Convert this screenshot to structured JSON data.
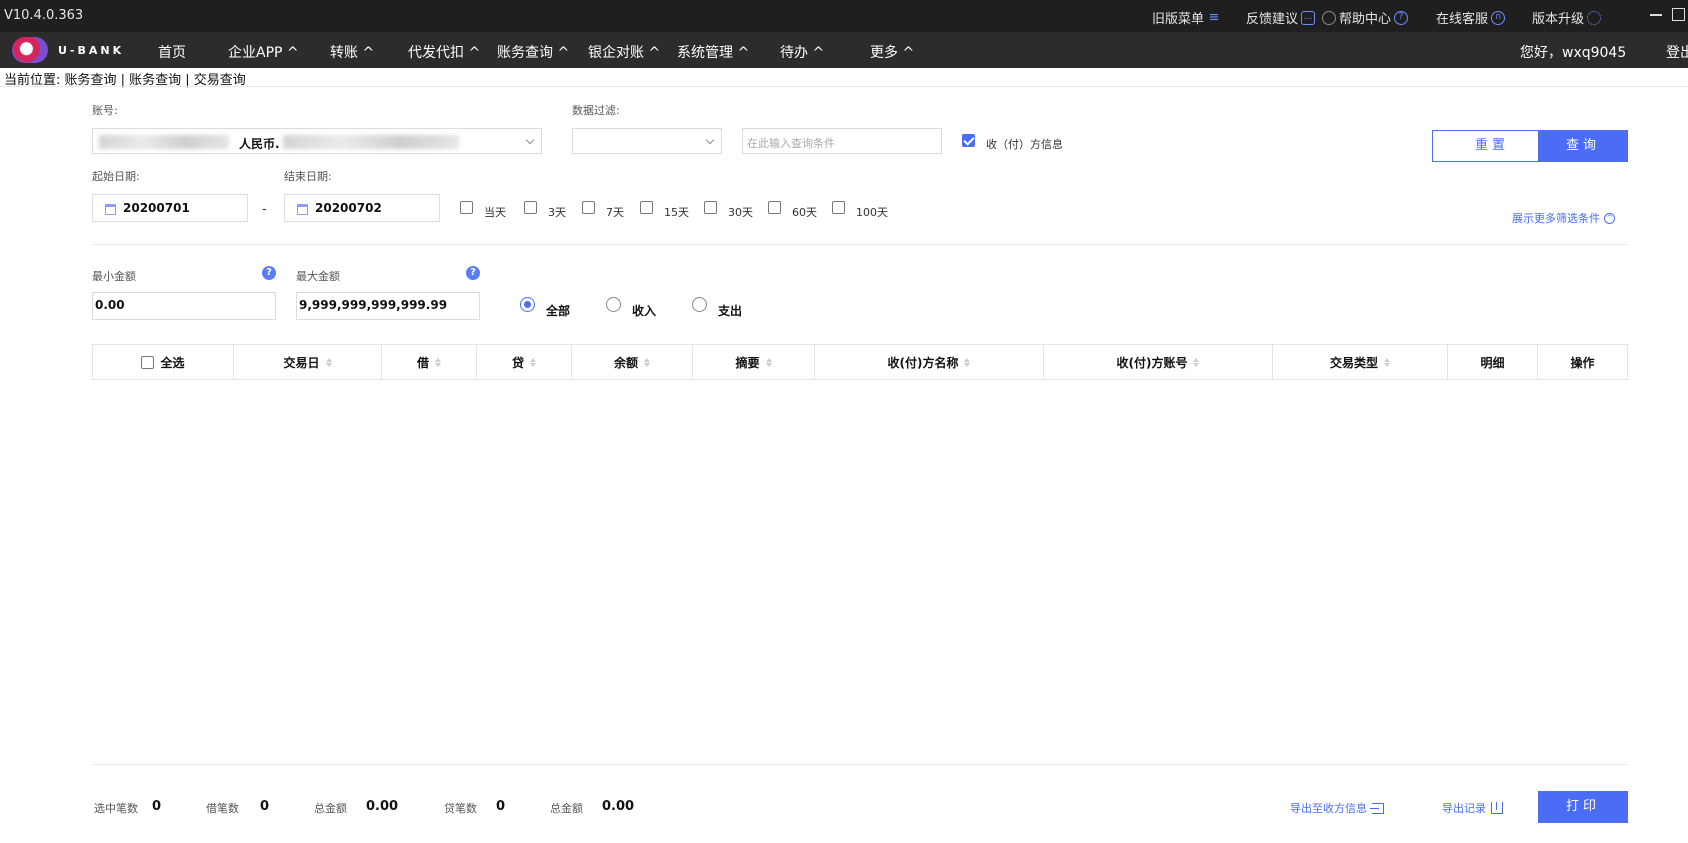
{
  "app": {
    "version": "V10.4.0.363"
  },
  "titlebar": {
    "links": [
      {
        "label": "旧版菜单",
        "icon": "menu-icon"
      },
      {
        "label": "反馈建议",
        "icon": "chat-icon"
      },
      {
        "label": "帮助中心",
        "icon": "help-circle-icon"
      },
      {
        "label": "在线客服",
        "icon": "headset-icon"
      },
      {
        "label": "版本升级",
        "icon": "refresh-icon"
      }
    ]
  },
  "navbar": {
    "logo_text": "U-BANK",
    "items": [
      "首页",
      "企业APP ^",
      "转账 ^",
      "代发代扣 ^",
      "账务查询 ^",
      "银企对账 ^",
      "系统管理 ^",
      "待办 ^",
      "更多 ^"
    ],
    "user_greeting": "您好，wxq9045",
    "logout": "登出"
  },
  "breadcrumb": {
    "text": "当前位置: 账务查询 | 账务查询 | 交易查询"
  },
  "form": {
    "account_label": "账号:",
    "account_currency": "人民币.",
    "filter_label": "数据过滤:",
    "filter_placeholder": "在此输入查询条件",
    "counterparty_checkbox_label": "收（付）方信息",
    "counterparty_checked": true,
    "start_date_label": "起始日期:",
    "start_date": "20200701",
    "end_date_label": "结束日期:",
    "end_date": "20200702",
    "date_separator": "-",
    "quick_ranges": [
      "当天",
      "3天",
      "7天",
      "15天",
      "30天",
      "60天",
      "100天"
    ],
    "reset_button": "重置",
    "query_button": "查询",
    "more_filters_link": "展示更多筛选条件",
    "min_amount_label": "最小金额",
    "min_amount": "0.00",
    "max_amount_label": "最大金额",
    "max_amount": "9,999,999,999,999.99",
    "help_icon_text": "?",
    "direction_options": [
      "全部",
      "收入",
      "支出"
    ],
    "direction_selected": "全部"
  },
  "table": {
    "select_all_label": "全选",
    "columns": [
      {
        "label": "交易日",
        "sortable": true
      },
      {
        "label": "借",
        "sortable": true
      },
      {
        "label": "贷",
        "sortable": true
      },
      {
        "label": "余额",
        "sortable": true
      },
      {
        "label": "摘要",
        "sortable": true
      },
      {
        "label": "收(付)方名称",
        "sortable": true
      },
      {
        "label": "收(付)方账号",
        "sortable": true
      },
      {
        "label": "交易类型",
        "sortable": true
      },
      {
        "label": "明细",
        "sortable": false
      },
      {
        "label": "操作",
        "sortable": false
      }
    ],
    "rows": []
  },
  "footer": {
    "selected_count_label": "选中笔数",
    "selected_count": "0",
    "debit_count_label": "借笔数",
    "debit_count": "0",
    "debit_total_label": "总金额",
    "debit_total": "0.00",
    "credit_count_label": "贷笔数",
    "credit_count": "0",
    "credit_total_label": "总金额",
    "credit_total": "0.00",
    "export_counterparty_link": "导出至收方信息",
    "export_records_link": "导出记录",
    "print_button": "打印"
  },
  "colors": {
    "accent": "#4a6cf7",
    "titlebar_bg": "#1f1f1f",
    "navbar_bg": "#2c2c2c"
  }
}
